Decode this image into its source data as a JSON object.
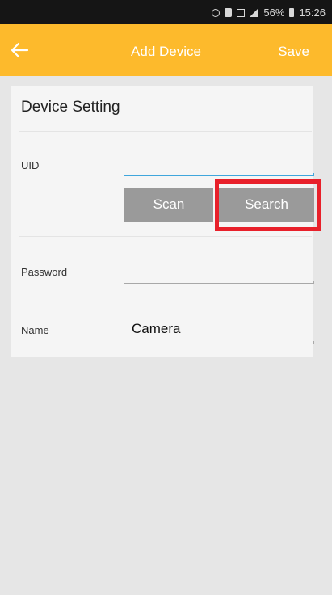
{
  "status_bar": {
    "battery_percent": "56%",
    "time": "15:26",
    "icons": [
      "alarm-icon",
      "battery-saver-icon",
      "data-icon",
      "signal-icon",
      "battery-icon"
    ]
  },
  "app_bar": {
    "back_icon": "arrow-left-icon",
    "title": "Add Device",
    "save_label": "Save",
    "background_color": "#fdba2c"
  },
  "device_setting": {
    "section_title": "Device Setting",
    "uid": {
      "label": "UID",
      "value": "",
      "placeholder": ""
    },
    "scan_label": "Scan",
    "search_label": "Search",
    "password": {
      "label": "Password",
      "value": "",
      "placeholder": ""
    },
    "name": {
      "label": "Name",
      "value": "Camera"
    }
  },
  "highlight_color": "#e8202a"
}
